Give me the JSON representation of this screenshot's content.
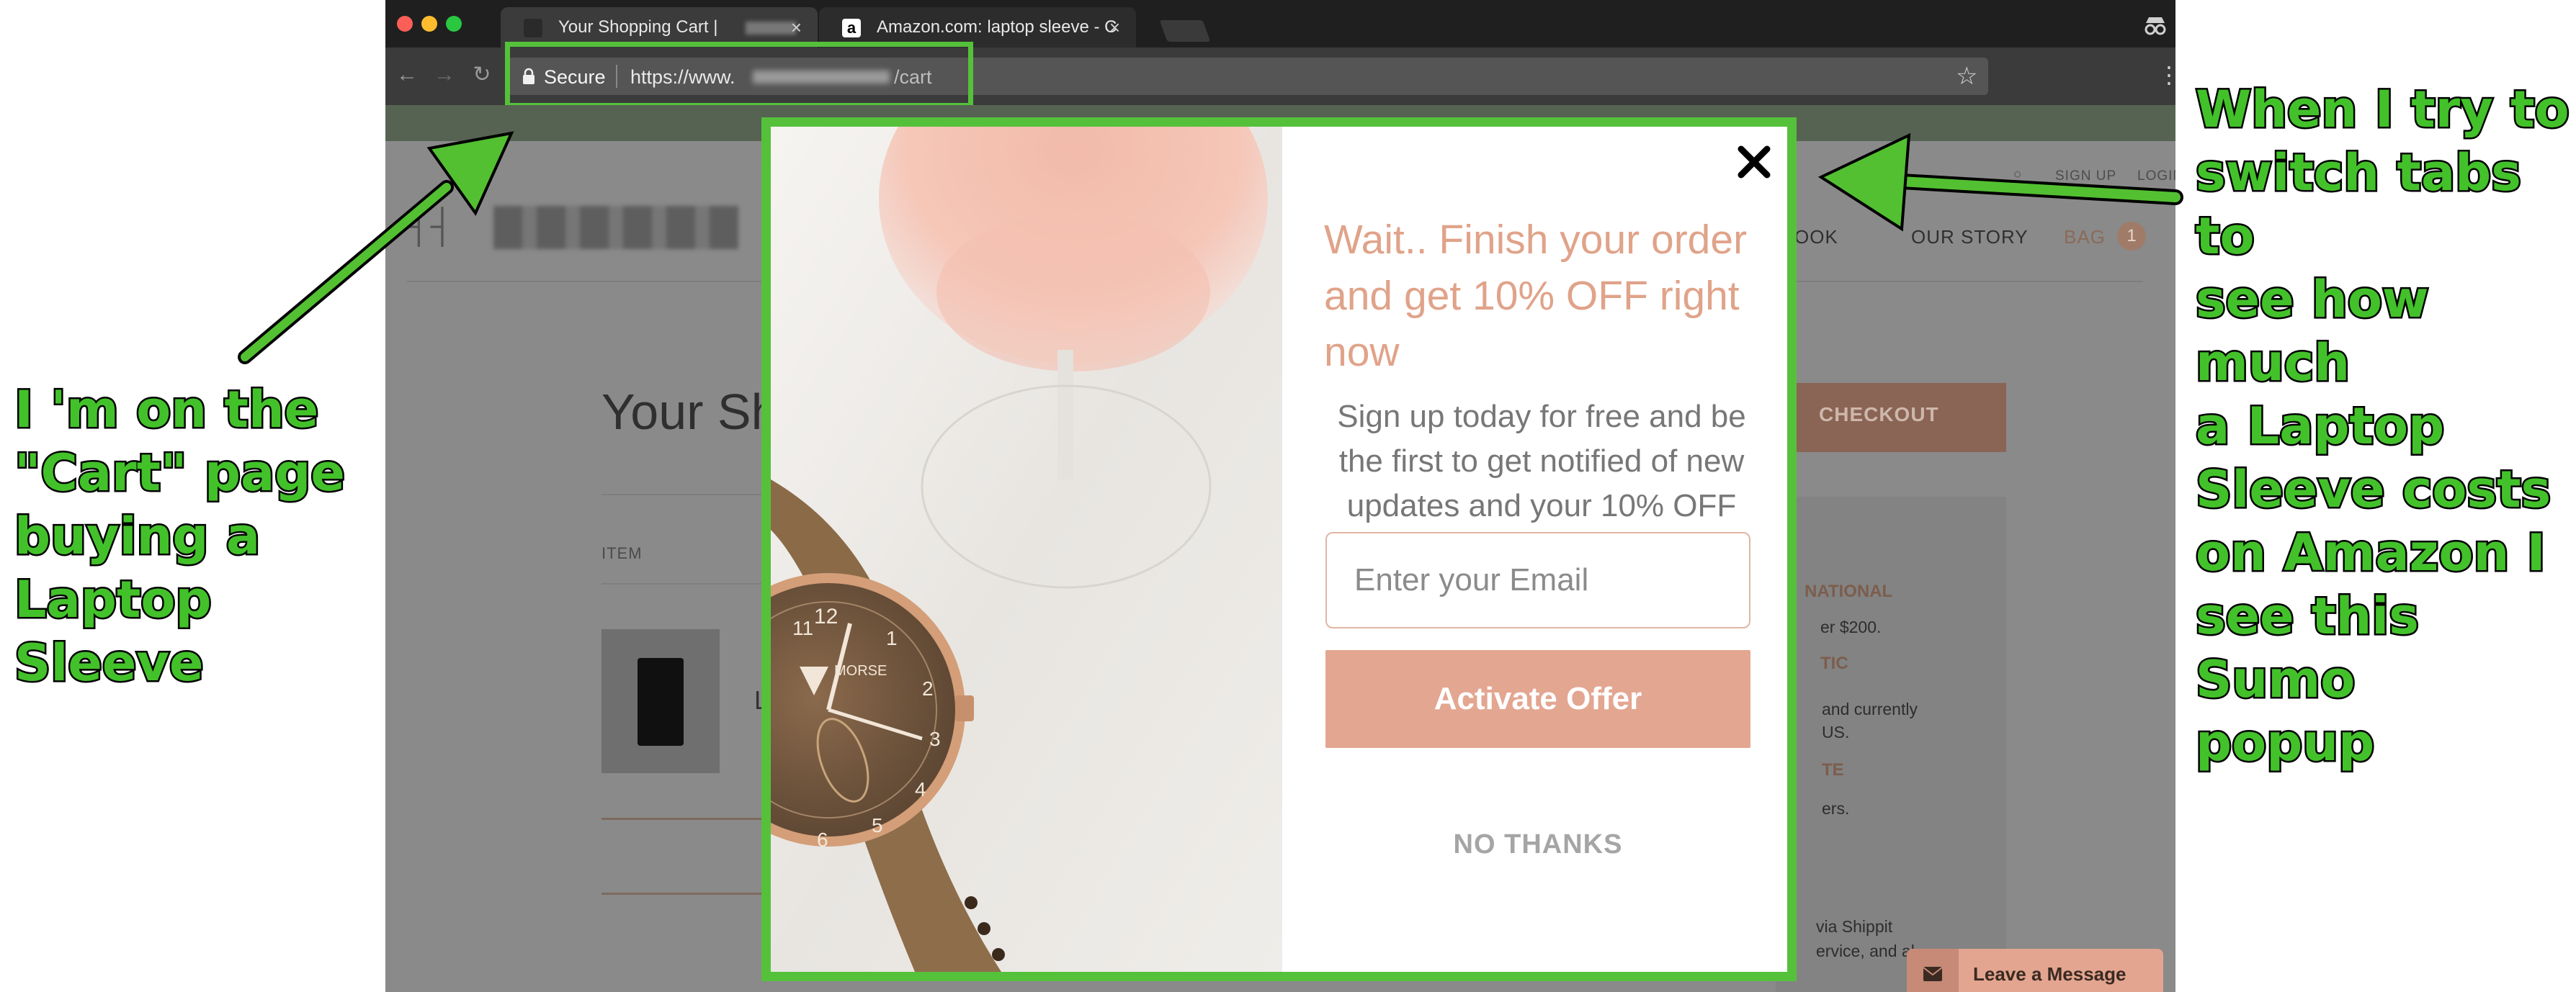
{
  "browser": {
    "tabs": [
      {
        "title": "Your Shopping Cart |",
        "active": true
      },
      {
        "title": "Amazon.com: laptop sleeve - C",
        "active": false
      }
    ],
    "tab_close_glyph": "×",
    "address": {
      "secure_label": "Secure",
      "url_prefix": "https://www.",
      "url_suffix": "/cart"
    }
  },
  "site": {
    "header_links": {
      "sign_up": "SIGN UP",
      "login": "LOGIN"
    },
    "nav": {
      "lookbook_partial": "OOK",
      "our_story": "OUR STORY",
      "bag_label": "BAG",
      "bag_count": "1"
    },
    "page_title_partial": "Your Sh",
    "checkout_partial": "CHECKOUT",
    "item_column": "ITEM",
    "cart_item_initial": "L",
    "sidebar_snippets": [
      "NATIONAL",
      "er $200.",
      "TIC",
      "and currently",
      "US.",
      "TE",
      "ers.",
      "via Shippit",
      "ervice, and al"
    ]
  },
  "modal": {
    "headline": "Wait.. Finish your order and get 10% OFF right now",
    "subtext": "Sign up today for free and be the first to get notified of new updates and your 10% OFF",
    "email_placeholder": "Enter your Email",
    "cta_label": "Activate Offer",
    "decline_label": "NO THANKS",
    "watch_brand": "MORSE"
  },
  "chat_widget": {
    "label": "Leave a Message"
  },
  "annotations": {
    "left": "I 'm on the\n\"Cart\" page\nbuying a\nLaptop Sleeve",
    "right": "When I try to\nswitch tabs to\nsee how much\na Laptop\nSleeve costs\non Amazon I\nsee this Sumo\npopup"
  },
  "colors": {
    "annotation_green": "#43c12a",
    "modal_frame": "#55c13b",
    "headline": "#e0a389",
    "cta": "#e3a691"
  }
}
